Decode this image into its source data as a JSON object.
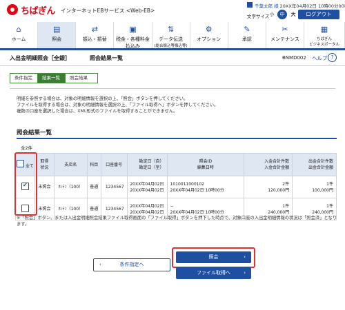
{
  "header": {
    "brand": "ちばぎん",
    "service": "インターネットEBサービス <Web-EB>",
    "user_name": "千葉太郎 様",
    "user_datetime": "20XX年04月02日 10時00分00秒",
    "font_size_label": "文字サイズ",
    "font_sizes": [
      "小",
      "中",
      "大"
    ],
    "logout": "ログアウト"
  },
  "nav": [
    {
      "label": "ホーム",
      "sub": "",
      "icon": "home-icon"
    },
    {
      "label": "照会",
      "sub": "",
      "icon": "document-icon"
    },
    {
      "label": "振込・振替",
      "sub": "",
      "icon": "transfer-icon"
    },
    {
      "label": "税金・各種料金",
      "sub": "払込み",
      "icon": "tax-icon"
    },
    {
      "label": "データ伝送",
      "sub": "(総合振込等振込等)",
      "icon": "data-icon"
    },
    {
      "label": "オプション",
      "sub": "",
      "icon": "option-icon"
    },
    {
      "label": "承認",
      "sub": "",
      "icon": "approve-icon"
    },
    {
      "label": "メンテナンス",
      "sub": "",
      "icon": "maintenance-icon"
    },
    {
      "label": "ちばぎん",
      "sub": "ビジネスポータル",
      "icon": "portal-icon"
    }
  ],
  "title": {
    "main": "入出金明細照会［全銀］",
    "sub": "照会結果一覧",
    "screen_id": "BNMD002",
    "help": "ヘルプ"
  },
  "steps": [
    "条件指定",
    "結果一覧",
    "照会結果"
  ],
  "notes": [
    "明細を参照する場合は、対象の明細情報を選択の上、「照会」ボタンを押してください。",
    "ファイルを取得する場合は、対象の明細情報を選択の上、「ファイル取得へ」ボタンを押してください。",
    "複数の口座を選択した場合は、XML形式のファイルを取得することができません。"
  ],
  "section_title": "照会結果一覧",
  "count": "全2件",
  "table": {
    "headers": {
      "select": "全て",
      "status": [
        "取得",
        "状況"
      ],
      "branch": "支店名",
      "subject": "科目",
      "account": "口座番号",
      "period": [
        "勘定日（自）",
        "勘定日（至）"
      ],
      "inquiry": [
        "照会ID",
        "編集日時"
      ],
      "deposit": [
        "入金合計件数",
        "入金合計金額"
      ],
      "withdrawal": [
        "出金合計件数",
        "出金合計金額"
      ]
    },
    "rows": [
      {
        "checked": true,
        "status": "未照会",
        "branch": "ﾎﾝﾃﾝ（100）",
        "subject": "普通",
        "account": "1234567",
        "period": [
          "20XX年04月02日",
          "20XX年04月02日"
        ],
        "inquiry": [
          "1010011000102",
          "20XX年04月02日 10時00分"
        ],
        "deposit": [
          "2件",
          "120,000円"
        ],
        "withdrawal": [
          "1件",
          "100,000円"
        ]
      },
      {
        "checked": false,
        "status": "未照会",
        "branch": "ﾎﾝﾃﾝ（100）",
        "subject": "普通",
        "account": "1234567",
        "period": [
          "20XX年04月02日",
          "20XX年04月02日"
        ],
        "inquiry": [
          "−",
          "20XX年04月02日 10時00分"
        ],
        "deposit": [
          "1件",
          "240,000円"
        ],
        "withdrawal": [
          "1件",
          "240,000円"
        ]
      }
    ]
  },
  "footnote": "※「照会」ボタン、または入出金明細照会結果ファイル取得画面の「ファイル取得」ボタンを押下した時点で、対象口座の入出金明細情報の状況は「照会済」となります。",
  "buttons": {
    "back": "条件指定へ",
    "inquire": "照会",
    "file": "ファイル取得へ"
  },
  "colors": {
    "brand_red": "#e60012",
    "primary_blue": "#1f4fa0",
    "step_green": "#3c7d36",
    "highlight_red": "#e23030"
  }
}
